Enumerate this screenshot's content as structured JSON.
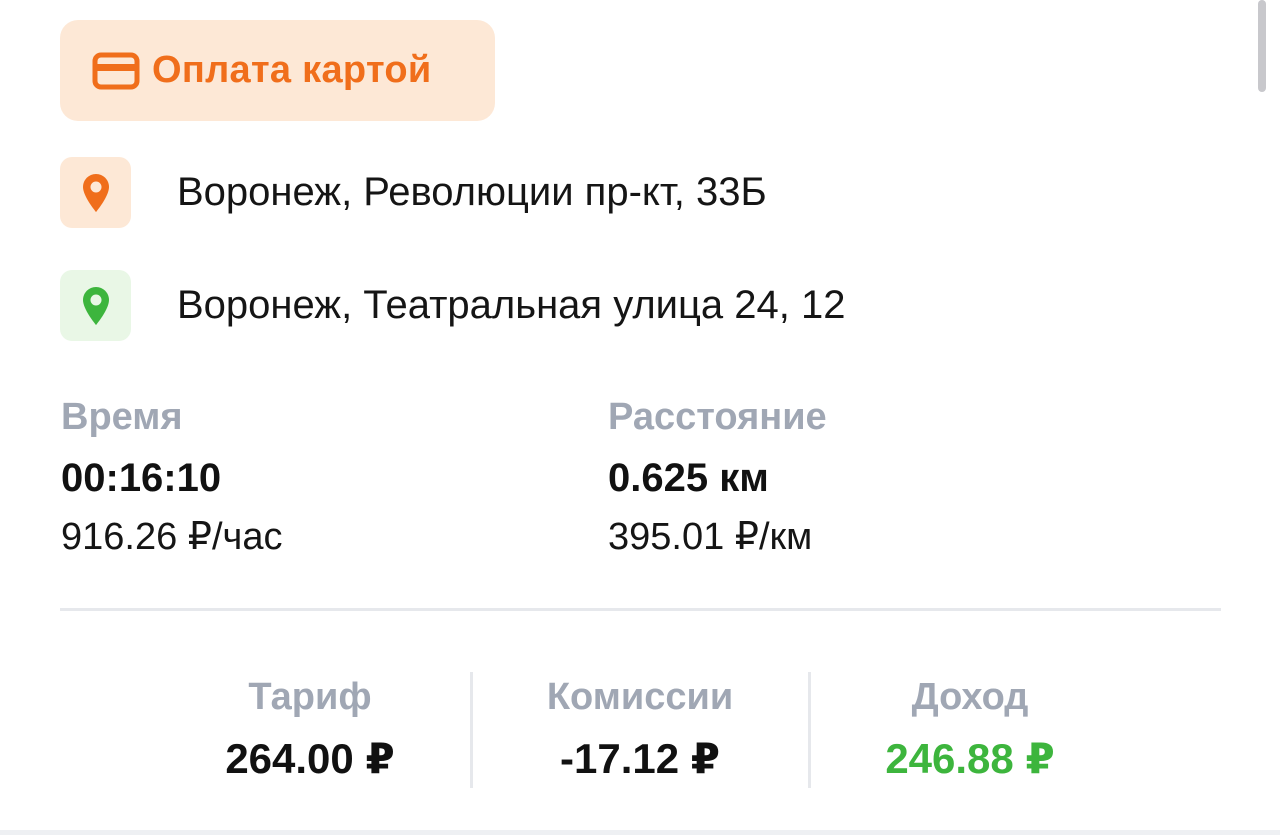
{
  "payment": {
    "label": "Оплата картой",
    "icon": "credit-card-icon",
    "color": "#f06e1b"
  },
  "route": {
    "from": {
      "address": "Воронеж, Революции пр-кт, 33Б",
      "icon": "map-pin-icon",
      "color": "#f06e1b"
    },
    "to": {
      "address": "Воронеж, Театральная улица 24, 12",
      "icon": "map-pin-icon",
      "color": "#3db53d"
    }
  },
  "metrics": {
    "time": {
      "label": "Время",
      "value": "00:16:10",
      "rate": "916.26 ₽/час"
    },
    "distance": {
      "label": "Расстояние",
      "value": "0.625 км",
      "rate": "395.01 ₽/км"
    }
  },
  "summary": {
    "tariff": {
      "label": "Тариф",
      "value": "264.00 ₽"
    },
    "commission": {
      "label": "Комиссии",
      "value": "-17.12 ₽"
    },
    "income": {
      "label": "Доход",
      "value": "246.88 ₽",
      "color": "#3db53d"
    }
  }
}
